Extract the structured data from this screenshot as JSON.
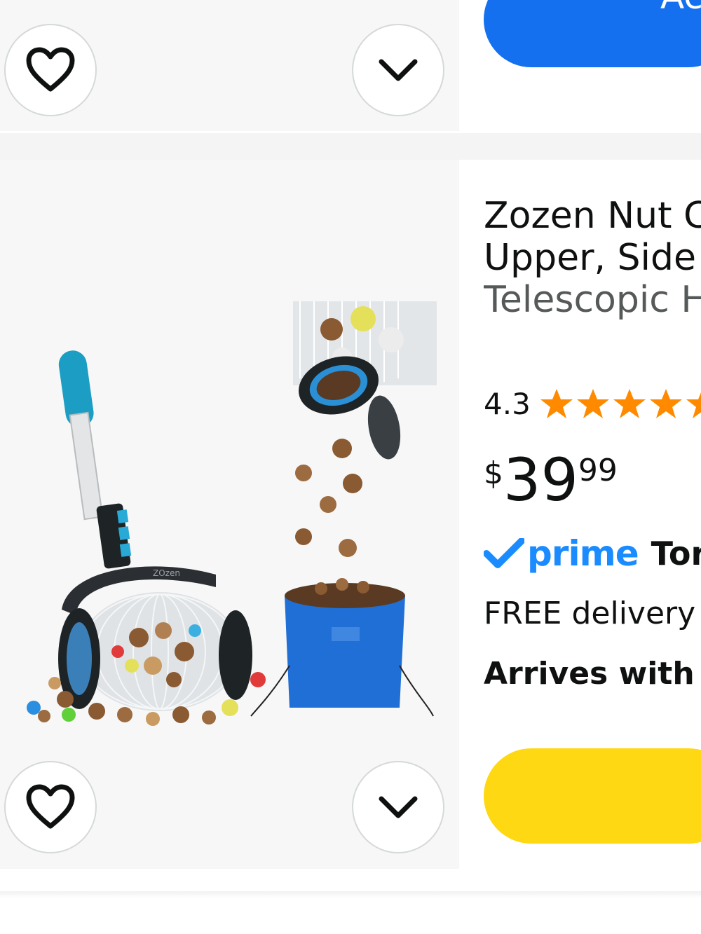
{
  "top_card": {
    "button_label": "Ac"
  },
  "product": {
    "title_line1": "Zozen Nut C",
    "title_line2": "Upper, Side",
    "title_line3": "Telescopic H",
    "rating": "4.3",
    "rating_value": 4.3,
    "price_currency": "$",
    "price_whole": "39",
    "price_fraction": "99",
    "prime_label": "prime",
    "prime_tail": "Tor",
    "delivery": "FREE delivery",
    "arrives": "Arrives with u",
    "image_brand_mark": "ZOzen"
  },
  "colors": {
    "accent_blue": "#1570ef",
    "accent_yellow": "#ffd814",
    "star_orange": "#ff8a00",
    "prime_blue": "#1a8cff"
  },
  "icons": {
    "favorite": "heart-outline-icon",
    "more": "chevron-down-icon",
    "prime_check": "checkmark-icon",
    "star": "star-icon"
  }
}
